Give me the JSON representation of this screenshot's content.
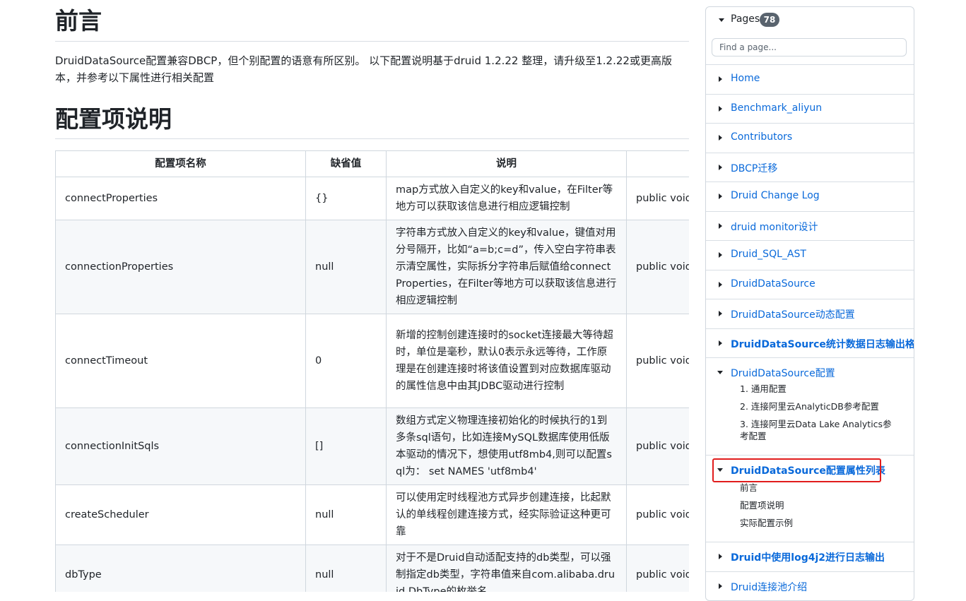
{
  "content": {
    "heading_intro": "前言",
    "intro_text": "DruidDataSource配置兼容DBCP，但个别配置的语意有所区别。 以下配置说明基于druid 1.2.22 整理，请升级至1.2.22或更高版本，并参考以下属性进行相关配置",
    "heading_config": "配置项说明",
    "table": {
      "headers": [
        "配置项名称",
        "缺省值",
        "说明",
        ""
      ],
      "rows": [
        {
          "name": "connectProperties",
          "default": "{}",
          "desc": "map方式放入自定义的key和value，在Filter等地方可以获取该信息进行相应逻辑控制",
          "setter": "public void"
        },
        {
          "name": "connectionProperties",
          "default": "null",
          "desc": "字符串方式放入自定义的key和value，键值对用分号隔开，比如“a=b;c=d”，传入空白字符串表示清空属性，实际拆分字符串后赋值给connectProperties，在Filter等地方可以获取该信息进行相应逻辑控制",
          "setter": "public void"
        },
        {
          "name": "connectTimeout",
          "default": "0",
          "desc": "新增的控制创建连接时的socket连接最大等待超时，单位是毫秒，默认0表示永远等待，工作原理是在创建连接时将该值设置到对应数据库驱动的属性信息中由其JDBC驱动进行控制",
          "setter": "public void"
        },
        {
          "name": "connectionInitSqls",
          "default": "[]",
          "desc": "数组方式定义物理连接初始化的时候执行的1到多条sql语句，比如连接MySQL数据库使用低版本驱动的情况下，想使用utf8mb4,则可以配置sql为： set NAMES 'utf8mb4'",
          "setter": "public void"
        },
        {
          "name": "createScheduler",
          "default": "null",
          "desc": "可以使用定时线程池方式异步创建连接，比起默认的单线程创建连接方式，经实际验证这种更可靠",
          "setter": "public void com.alibab"
        },
        {
          "name": "dbType",
          "default": "null",
          "desc": "对于不是Druid自动适配支持的db类型，可以强制指定db类型，字符串值来自com.alibaba.druid.DbType的枚举名",
          "setter": "public void"
        }
      ]
    }
  },
  "sidebar": {
    "pages_label": "Pages",
    "pages_count": "78",
    "search_placeholder": "Find a page...",
    "items": [
      {
        "label": "Home"
      },
      {
        "label": "Benchmark_aliyun"
      },
      {
        "label": "Contributors"
      },
      {
        "label": "DBCP迁移"
      },
      {
        "label": "Druid Change Log"
      },
      {
        "label": "druid monitor设计"
      },
      {
        "label": "Druid_SQL_AST"
      },
      {
        "label": "DruidDataSource"
      },
      {
        "label": "DruidDataSource动态配置"
      },
      {
        "label": "DruidDataSource统计数据日志输出格式"
      },
      {
        "label": "DruidDataSource配置",
        "children": [
          "1. 通用配置",
          "2. 连接阿里云AnalyticDB参考配置",
          "3. 连接阿里云Data Lake Analytics参考配置"
        ]
      },
      {
        "label": "DruidDataSource配置属性列表",
        "children": [
          "前言",
          "配置项说明",
          "实际配置示例"
        ]
      },
      {
        "label": "Druid中使用log4j2进行日志输出"
      },
      {
        "label": "Druid连接池介绍"
      }
    ],
    "accent_color": "#0969da",
    "highlight_color": "#e11d1d"
  }
}
